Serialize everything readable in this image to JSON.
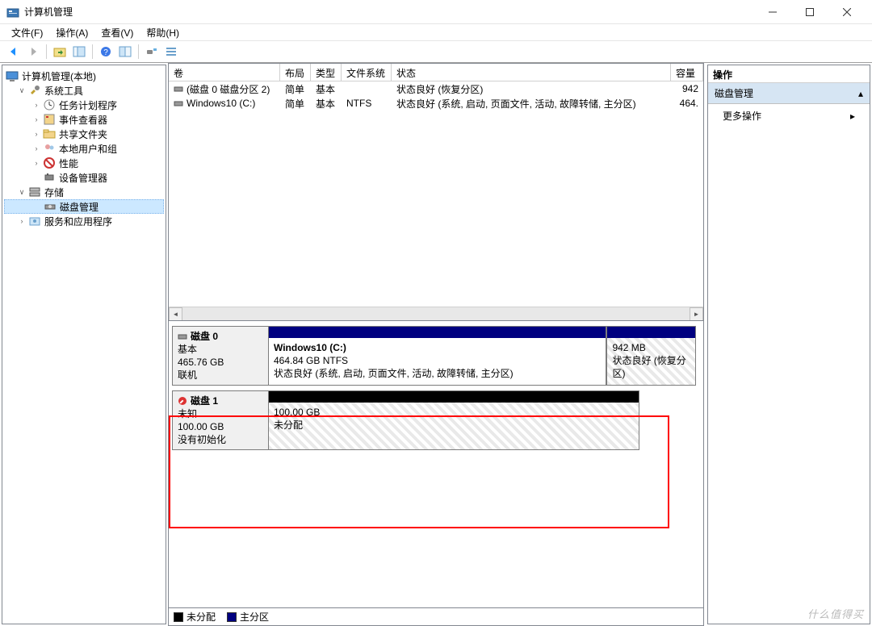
{
  "window": {
    "title": "计算机管理"
  },
  "menu": {
    "file": "文件(F)",
    "action": "操作(A)",
    "view": "查看(V)",
    "help": "帮助(H)"
  },
  "tree": {
    "root": "计算机管理(本地)",
    "systemTools": "系统工具",
    "taskScheduler": "任务计划程序",
    "eventViewer": "事件查看器",
    "sharedFolders": "共享文件夹",
    "localUsers": "本地用户和组",
    "performance": "性能",
    "deviceManager": "设备管理器",
    "storage": "存储",
    "diskManagement": "磁盘管理",
    "services": "服务和应用程序"
  },
  "columns": {
    "volume": "卷",
    "layout": "布局",
    "type": "类型",
    "fs": "文件系统",
    "status": "状态",
    "capacity": "容量"
  },
  "volumes": [
    {
      "name": "(磁盘 0 磁盘分区 2)",
      "layout": "简单",
      "type": "基本",
      "fs": "",
      "status": "状态良好 (恢复分区)",
      "capacity": "942"
    },
    {
      "name": "Windows10 (C:)",
      "layout": "简单",
      "type": "基本",
      "fs": "NTFS",
      "status": "状态良好 (系统, 启动, 页面文件, 活动, 故障转储, 主分区)",
      "capacity": "464."
    }
  ],
  "disks": [
    {
      "name": "磁盘 0",
      "kind": "基本",
      "size": "465.76 GB",
      "state": "联机",
      "partitions": [
        {
          "title": "Windows10  (C:)",
          "line2": "464.84 GB NTFS",
          "line3": "状态良好 (系统, 启动, 页面文件, 活动, 故障转储, 主分区)",
          "ptype": "primary",
          "flex": 5
        },
        {
          "title": "",
          "line2": "942 MB",
          "line3": "状态良好 (恢复分区)",
          "ptype": "recovery",
          "flex": 1.3
        }
      ]
    },
    {
      "name": "磁盘 1",
      "kind": "未知",
      "size": "100.00 GB",
      "state": "没有初始化",
      "warning": true,
      "partitions": [
        {
          "title": "",
          "line2": "100.00 GB",
          "line3": "未分配",
          "ptype": "unallocated",
          "flex": 1
        }
      ]
    }
  ],
  "legend": {
    "unallocated": "未分配",
    "primary": "主分区"
  },
  "actions": {
    "header": "操作",
    "section": "磁盘管理",
    "more": "更多操作"
  },
  "watermark": "什么值得买"
}
